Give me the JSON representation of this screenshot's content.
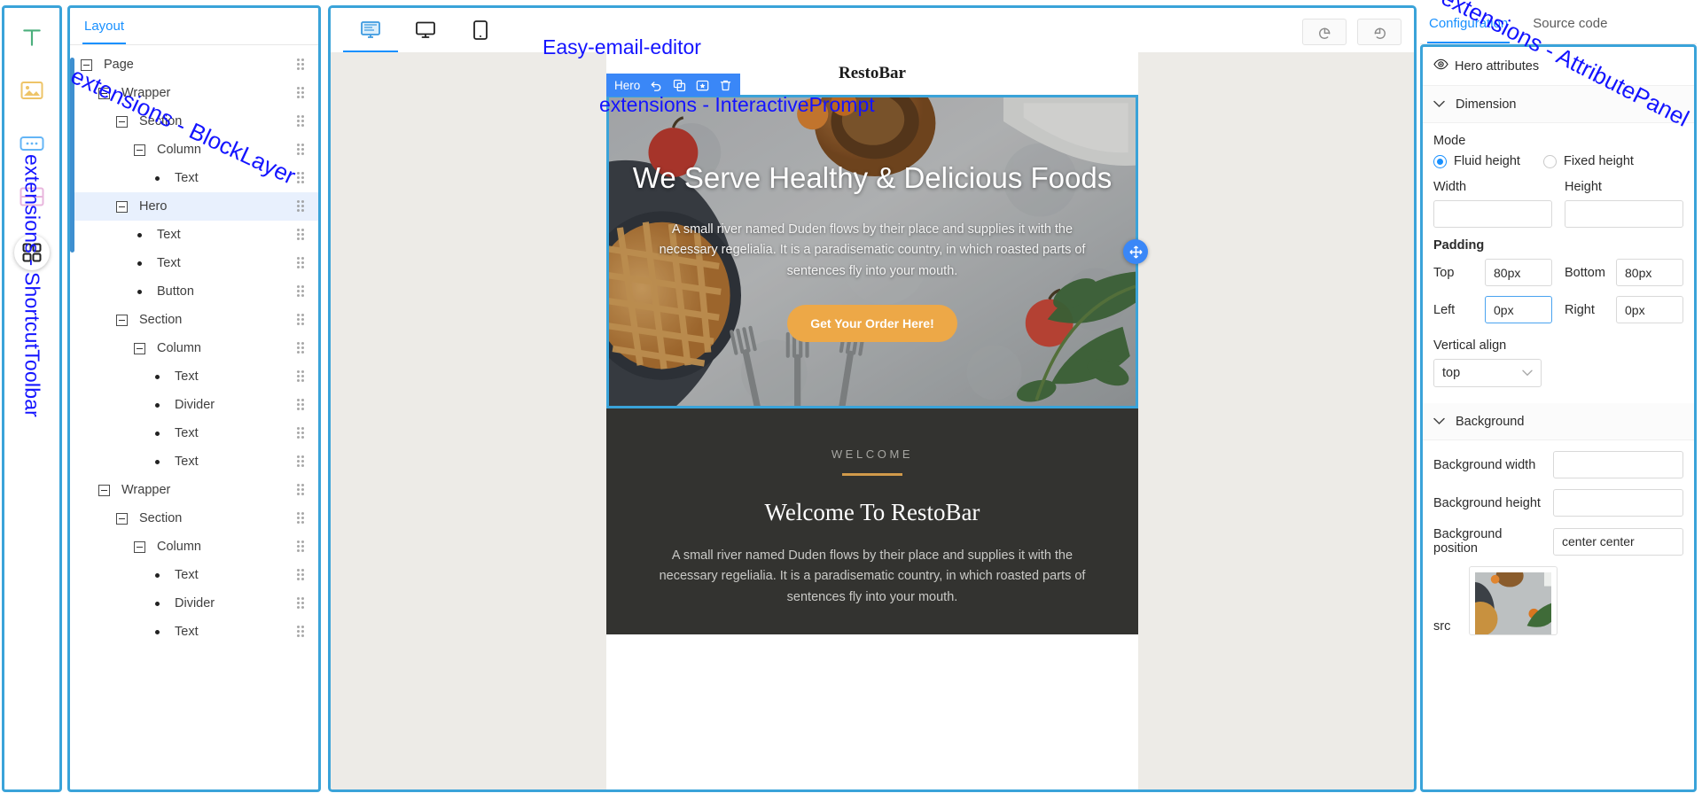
{
  "annotations": {
    "shortcut_toolbar": "extensions - ShortcutToolbar",
    "block_layer": "extensions - BlockLayer",
    "easy_email_editor": "Easy-email-editor",
    "interactive_prompt": "extensions - InteractivePrompt",
    "attribute_panel": "extensions - AttributePanel",
    "color": "#1414ff"
  },
  "shortcut_toolbar": {
    "items": [
      {
        "name": "text-tool",
        "icon": "T"
      },
      {
        "name": "image-tool",
        "icon": "image"
      },
      {
        "name": "button-tool",
        "icon": "button"
      },
      {
        "name": "divider-tool",
        "icon": "split"
      },
      {
        "name": "grid-tool",
        "icon": "grid"
      }
    ]
  },
  "block_layer": {
    "tab_label": "Layout",
    "tree": [
      {
        "label": "Page",
        "depth": 0,
        "type": "node",
        "selected": false
      },
      {
        "label": "Wrapper",
        "depth": 1,
        "type": "node",
        "selected": false
      },
      {
        "label": "Section",
        "depth": 2,
        "type": "node",
        "selected": false
      },
      {
        "label": "Column",
        "depth": 3,
        "type": "node",
        "selected": false
      },
      {
        "label": "Text",
        "depth": 4,
        "type": "leaf",
        "selected": false
      },
      {
        "label": "Hero",
        "depth": 2,
        "type": "node",
        "selected": true
      },
      {
        "label": "Text",
        "depth": 3,
        "type": "leaf",
        "selected": false
      },
      {
        "label": "Text",
        "depth": 3,
        "type": "leaf",
        "selected": false
      },
      {
        "label": "Button",
        "depth": 3,
        "type": "leaf",
        "selected": false
      },
      {
        "label": "Section",
        "depth": 2,
        "type": "node",
        "selected": false
      },
      {
        "label": "Column",
        "depth": 3,
        "type": "node",
        "selected": false
      },
      {
        "label": "Text",
        "depth": 4,
        "type": "leaf",
        "selected": false
      },
      {
        "label": "Divider",
        "depth": 4,
        "type": "leaf",
        "selected": false
      },
      {
        "label": "Text",
        "depth": 4,
        "type": "leaf",
        "selected": false
      },
      {
        "label": "Text",
        "depth": 4,
        "type": "leaf",
        "selected": false
      },
      {
        "label": "Wrapper",
        "depth": 1,
        "type": "node",
        "selected": false
      },
      {
        "label": "Section",
        "depth": 2,
        "type": "node",
        "selected": false
      },
      {
        "label": "Column",
        "depth": 3,
        "type": "node",
        "selected": false
      },
      {
        "label": "Text",
        "depth": 4,
        "type": "leaf",
        "selected": false
      },
      {
        "label": "Divider",
        "depth": 4,
        "type": "leaf",
        "selected": false
      },
      {
        "label": "Text",
        "depth": 4,
        "type": "leaf",
        "selected": false
      }
    ]
  },
  "editor": {
    "device_tabs": [
      {
        "name": "desktop-edit-view",
        "icon": "desktop-edit",
        "active": true
      },
      {
        "name": "desktop-preview-view",
        "icon": "monitor",
        "active": false
      },
      {
        "name": "mobile-preview-view",
        "icon": "mobile",
        "active": false
      }
    ],
    "undo_label": "undo",
    "redo_label": "redo",
    "brand_title": "RestoBar",
    "selected_block": {
      "label": "Hero",
      "actions": [
        "undo-icon",
        "copy-icon",
        "add-to-favorites-icon",
        "delete-icon"
      ]
    },
    "hero": {
      "heading": "We Serve Healthy & Delicious Foods",
      "paragraph": "A small river named Duden flows by their place and supplies it with the necessary regelialia. It is a paradisematic country, in which roasted parts of sentences fly into your mouth.",
      "button_label": "Get Your Order Here!",
      "button_color": "#eda847"
    },
    "welcome": {
      "kicker": "WELCOME",
      "heading": "Welcome To RestoBar",
      "paragraph": "A small river named Duden flows by their place and supplies it with the necessary regelialia. It is a paradisematic country, in which roasted parts of sentences fly into your mouth.",
      "rule_color": "#d19a4a",
      "background": "#333330"
    }
  },
  "attribute_panel": {
    "tabs": [
      {
        "label": "Configuration",
        "active": true
      },
      {
        "label": "Source code",
        "active": false
      }
    ],
    "header": "Hero attributes",
    "sections": {
      "dimension": {
        "title": "Dimension",
        "mode_label": "Mode",
        "mode_options": [
          {
            "label": "Fluid height",
            "checked": true
          },
          {
            "label": "Fixed height",
            "checked": false
          }
        ],
        "width_label": "Width",
        "width_value": "",
        "height_label": "Height",
        "height_value": "",
        "padding_label": "Padding",
        "padding": [
          {
            "label": "Top",
            "value": "80px",
            "focused": false
          },
          {
            "label": "Bottom",
            "value": "80px",
            "focused": false
          },
          {
            "label": "Left",
            "value": "0px",
            "focused": true
          },
          {
            "label": "Right",
            "value": "0px",
            "focused": false
          }
        ],
        "vertical_align_label": "Vertical align",
        "vertical_align_value": "top"
      },
      "background": {
        "title": "Background",
        "fields": [
          {
            "label": "Background width",
            "value": ""
          },
          {
            "label": "Background height",
            "value": ""
          },
          {
            "label": "Background position",
            "value": "center center"
          }
        ],
        "src_label": "src"
      }
    }
  }
}
